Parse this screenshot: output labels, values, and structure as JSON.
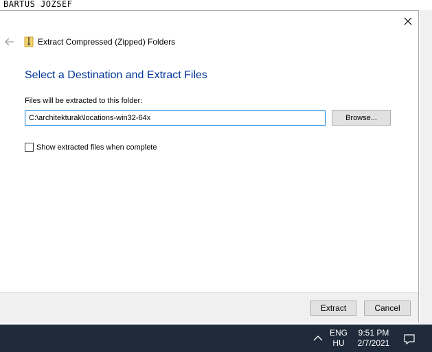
{
  "background": {
    "label": "BARTUS JOZSEF"
  },
  "dialog": {
    "app_title": "Extract Compressed (Zipped) Folders",
    "heading": "Select a Destination and Extract Files",
    "folder_label": "Files will be extracted to this folder:",
    "path_value": "C:\\architekturak\\locations-win32-64x",
    "browse_label": "Browse...",
    "checkbox_label": "Show extracted files when complete",
    "checkbox_checked": false,
    "extract_label": "Extract",
    "cancel_label": "Cancel"
  },
  "taskbar": {
    "lang_top": "ENG",
    "lang_bottom": "HU",
    "time": "9:51 PM",
    "date": "2/7/2021"
  },
  "icons": {
    "close": "close-icon",
    "back": "back-arrow-icon",
    "app": "zip-folder-icon",
    "tray": "chevron-up-icon",
    "notifications": "notification-icon"
  },
  "colors": {
    "heading": "#003399",
    "input_border": "#0078d7",
    "taskbar": "#1f2a3a"
  }
}
